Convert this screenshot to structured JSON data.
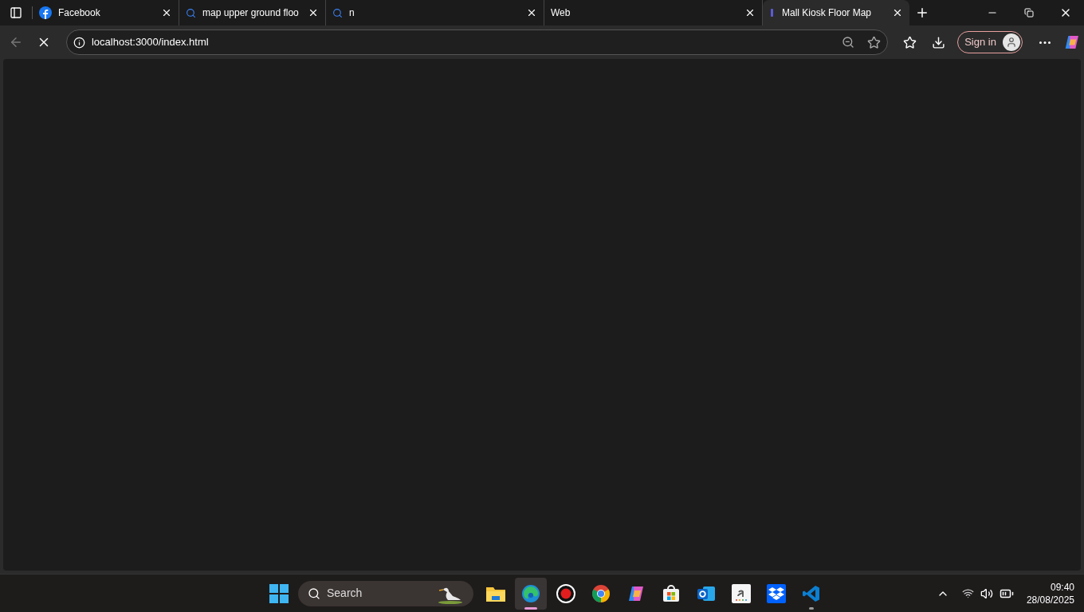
{
  "browser": {
    "tabs": [
      {
        "title": "Facebook",
        "kind": "facebook",
        "selected": false
      },
      {
        "title": "map upper ground floo",
        "kind": "search",
        "selected": false
      },
      {
        "title": "n",
        "kind": "search",
        "selected": false
      },
      {
        "title": "Web",
        "kind": "blank",
        "selected": false
      },
      {
        "title": "Mall Kiosk Floor Map",
        "kind": "page",
        "selected": true
      }
    ],
    "address": "localhost:3000/index.html",
    "loading": true,
    "sign_in": "Sign in"
  },
  "taskbar": {
    "search": "Search",
    "apps": [
      {
        "kind": "folder",
        "active": false,
        "running": false
      },
      {
        "kind": "edge",
        "active": true,
        "running": true
      },
      {
        "kind": "record",
        "active": false,
        "running": false
      },
      {
        "kind": "chrome",
        "active": false,
        "running": false
      },
      {
        "kind": "copilot",
        "active": false,
        "running": false
      },
      {
        "kind": "store",
        "active": false,
        "running": false
      },
      {
        "kind": "outlook",
        "active": false,
        "running": false
      },
      {
        "kind": "amazon",
        "active": false,
        "running": false
      },
      {
        "kind": "dropbox",
        "active": false,
        "running": false
      },
      {
        "kind": "code",
        "active": false,
        "running": true
      }
    ],
    "time": "09:40",
    "date": "28/08/2025"
  }
}
